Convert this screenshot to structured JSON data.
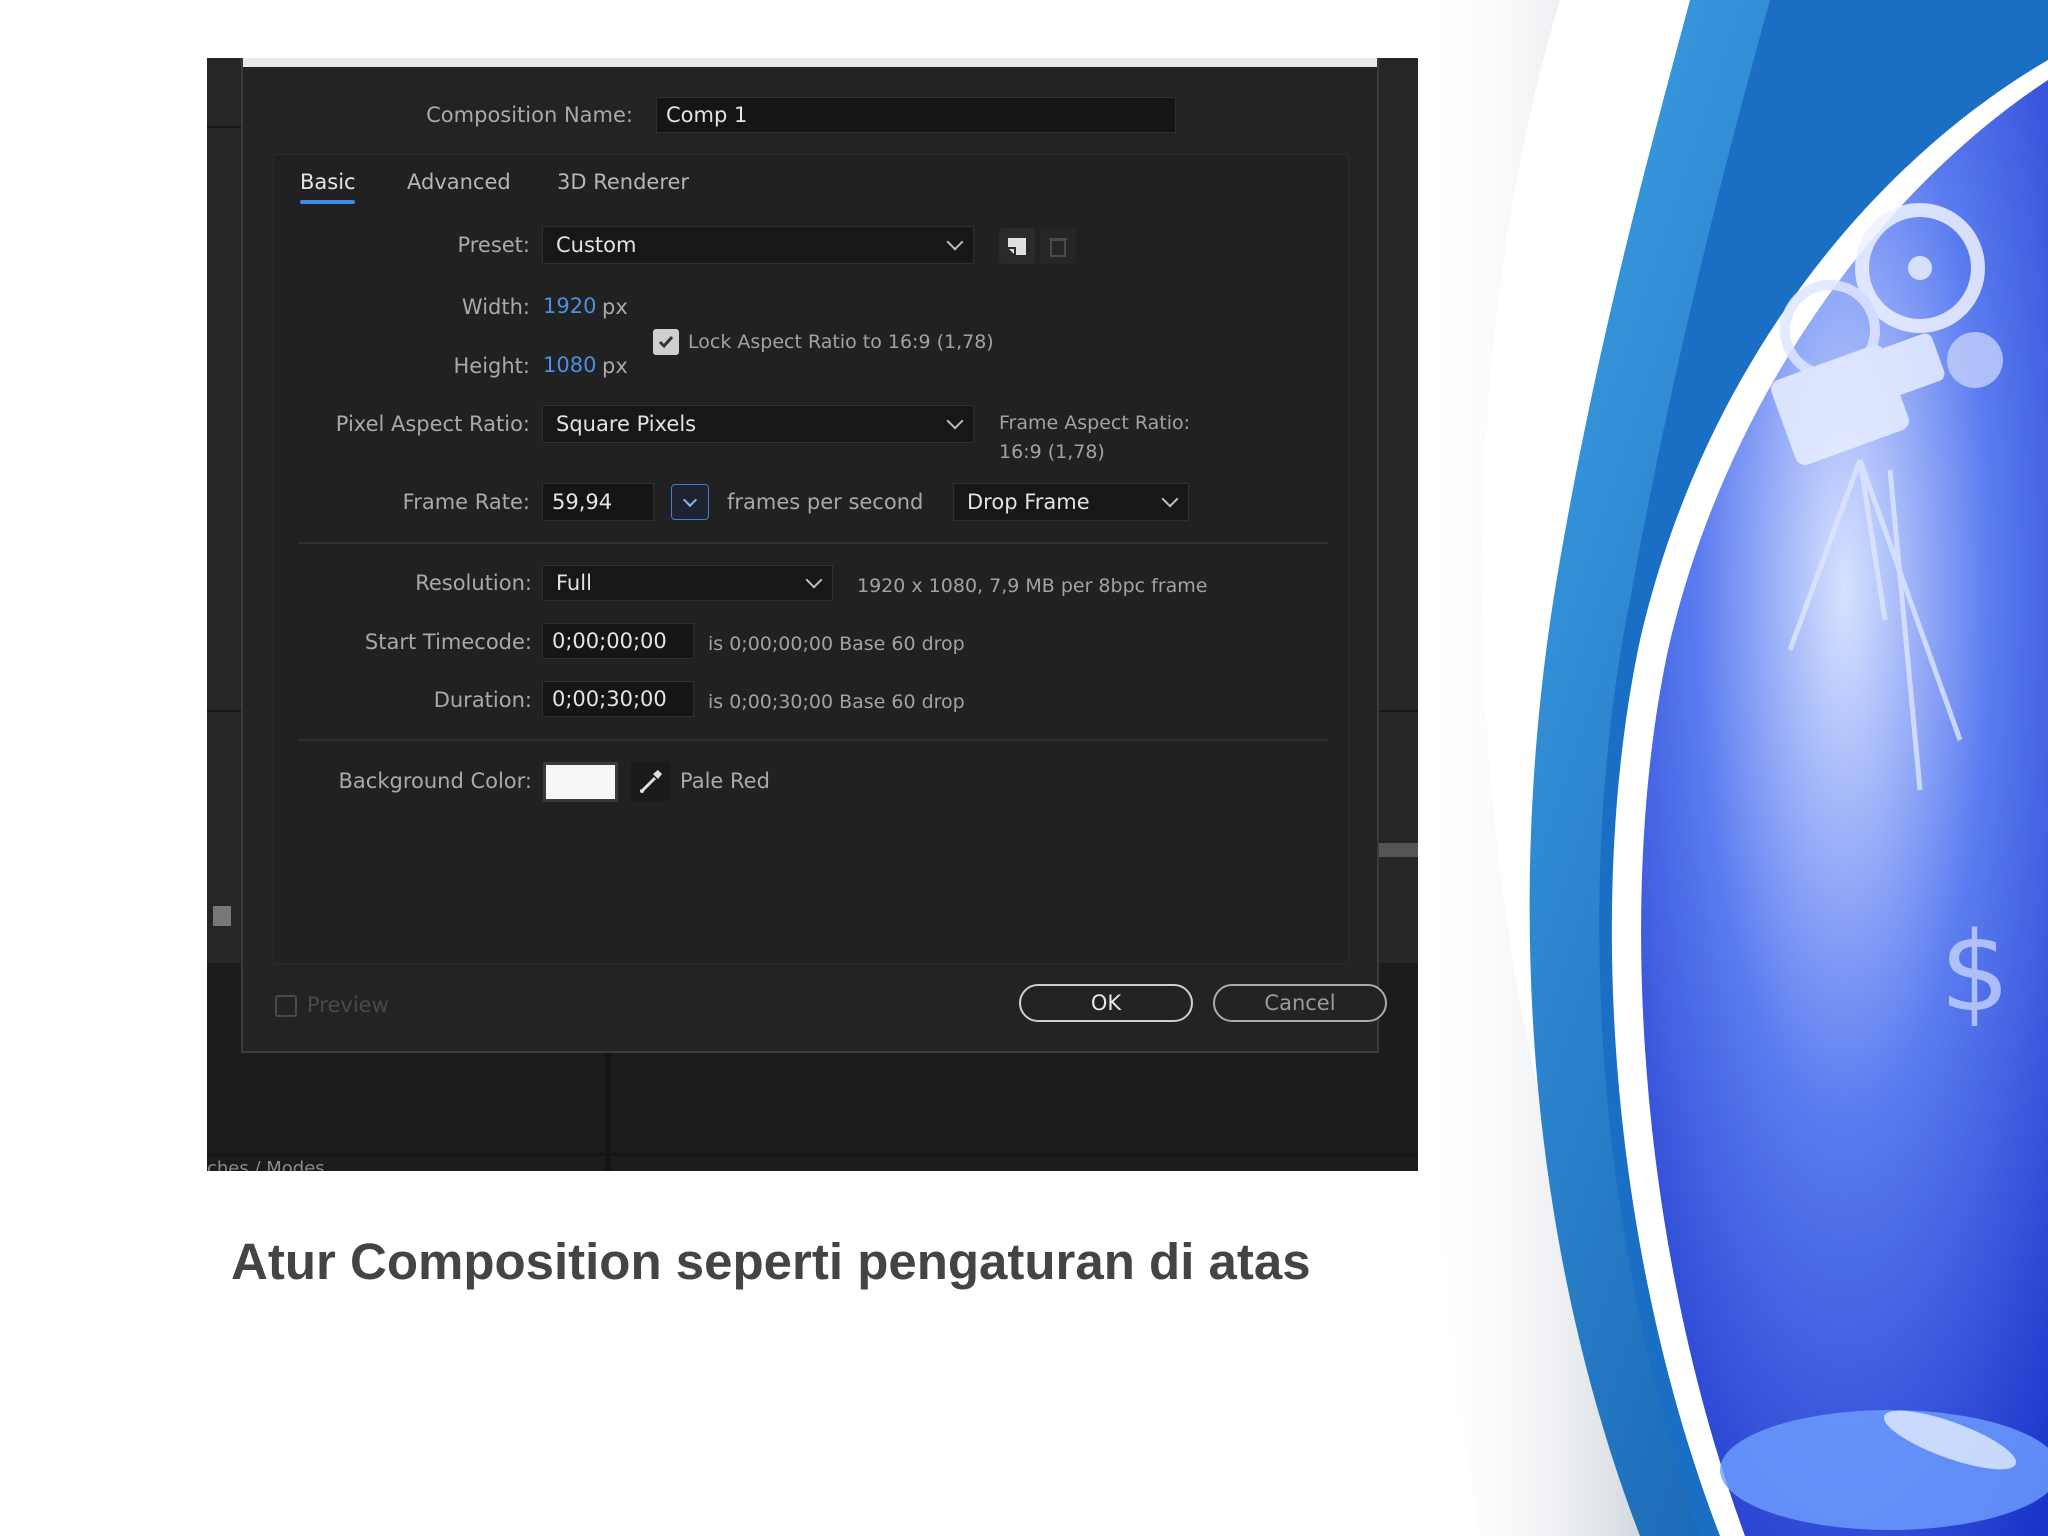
{
  "dialog": {
    "composition_name_label": "Composition Name:",
    "composition_name_value": "Comp 1",
    "tabs": [
      "Basic",
      "Advanced",
      "3D Renderer"
    ],
    "preset_label": "Preset:",
    "preset_value": "Custom",
    "width_label": "Width:",
    "width_value": "1920",
    "height_label": "Height:",
    "height_value": "1080",
    "unit_px": "px",
    "lock_aspect_label": "Lock Aspect Ratio to 16:9 (1,78)",
    "pixel_aspect_label": "Pixel Aspect Ratio:",
    "pixel_aspect_value": "Square Pixels",
    "frame_aspect_label": "Frame Aspect Ratio:",
    "frame_aspect_value": "16:9 (1,78)",
    "frame_rate_label": "Frame Rate:",
    "frame_rate_value": "59,94",
    "frame_rate_unit": "frames per second",
    "drop_frame_value": "Drop Frame",
    "resolution_label": "Resolution:",
    "resolution_value": "Full",
    "resolution_info": "1920 x 1080, 7,9 MB per 8bpc frame",
    "start_timecode_label": "Start Timecode:",
    "start_timecode_value": "0;00;00;00",
    "start_timecode_info": "is 0;00;00;00  Base 60  drop",
    "duration_label": "Duration:",
    "duration_value": "0;00;30;00",
    "duration_info": "is 0;00;30;00  Base 60  drop",
    "background_color_label": "Background Color:",
    "background_color_name": "Pale Red",
    "preview_label": "Preview",
    "ok_label": "OK",
    "cancel_label": "Cancel"
  },
  "background_fragment": "ches / Modes",
  "caption": "Atur Composition seperti pengaturan di atas",
  "colors": {
    "accent_blue": "#4b8fe0",
    "dialog_bg": "#232323",
    "slide_blue": "#1e4fd8"
  }
}
